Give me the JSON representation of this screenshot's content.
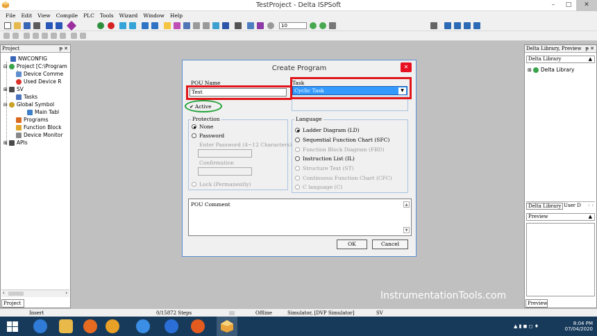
{
  "window": {
    "title": "TestProject - Delta ISPSoft",
    "min": "–",
    "max": "□",
    "close": "✕"
  },
  "menu": [
    "File",
    "Edit",
    "View",
    "Compile",
    "PLC",
    "Tools",
    "Wizard",
    "Window",
    "Help"
  ],
  "toolbar": {
    "zoom_value": "10"
  },
  "left_panel": {
    "header": "Project",
    "tree": [
      {
        "label": "NWCONFIG"
      },
      {
        "label": "Project [C:\\Program"
      },
      {
        "label": "Device Comme"
      },
      {
        "label": "Used Device R"
      },
      {
        "label": "SV"
      },
      {
        "label": "Tasks"
      },
      {
        "label": "Global Symbol"
      },
      {
        "label": "Main Tabl"
      },
      {
        "label": "Programs"
      },
      {
        "label": "Function Block"
      },
      {
        "label": "Device Monitor"
      },
      {
        "label": "APIs"
      }
    ],
    "bottom_tab": "Project"
  },
  "right_panel": {
    "header": "Delta Library, Preview",
    "dropdown": "Delta Library",
    "tree_item": "Delta Library",
    "tabs": [
      "Delta Library",
      "User D"
    ],
    "preview_label": "Preview",
    "bottom_tab": "Preview"
  },
  "dialog": {
    "title": "Create Program",
    "pou_name_label": "POU Name",
    "pou_name_value": "Test",
    "task_label": "Task",
    "task_value": "Cyclic Task",
    "active_label": "Active",
    "protection": {
      "label": "Protection",
      "none": "None",
      "password": "Password",
      "enter_password": "Enter Password (4~12 Characters)",
      "confirmation": "Confirmation",
      "lock": "Lock (Permanently)"
    },
    "language": {
      "label": "Language",
      "options": [
        {
          "label": "Ladder Diagram (LD)",
          "selected": true,
          "enabled": true
        },
        {
          "label": "Sequential Function Chart (SFC)",
          "selected": false,
          "enabled": true
        },
        {
          "label": "Function Block Diagram (FBD)",
          "selected": false,
          "enabled": false
        },
        {
          "label": "Instruction List (IL)",
          "selected": false,
          "enabled": true
        },
        {
          "label": "Structure Text (ST)",
          "selected": false,
          "enabled": false
        },
        {
          "label": "Continuous Function Chart (CFC)",
          "selected": false,
          "enabled": false
        },
        {
          "label": "C language (C)",
          "selected": false,
          "enabled": false
        }
      ]
    },
    "comment_label": "POU Comment",
    "ok": "OK",
    "cancel": "Cancel"
  },
  "statusbar": {
    "mode": "Insert",
    "steps": "0/15872 Steps",
    "status": "Offline",
    "simulator": "Simulator, [DVP Simulator]",
    "sv": "SV"
  },
  "watermark": "InstrumentationTools.com",
  "taskbar": {
    "time": "8:04 PM",
    "date": "07/04/2020"
  },
  "colors": {
    "highlight_red": "#e0151a",
    "highlight_green": "#22a33a",
    "task_select": "#3399ff",
    "taskbar": "#173a5b"
  }
}
